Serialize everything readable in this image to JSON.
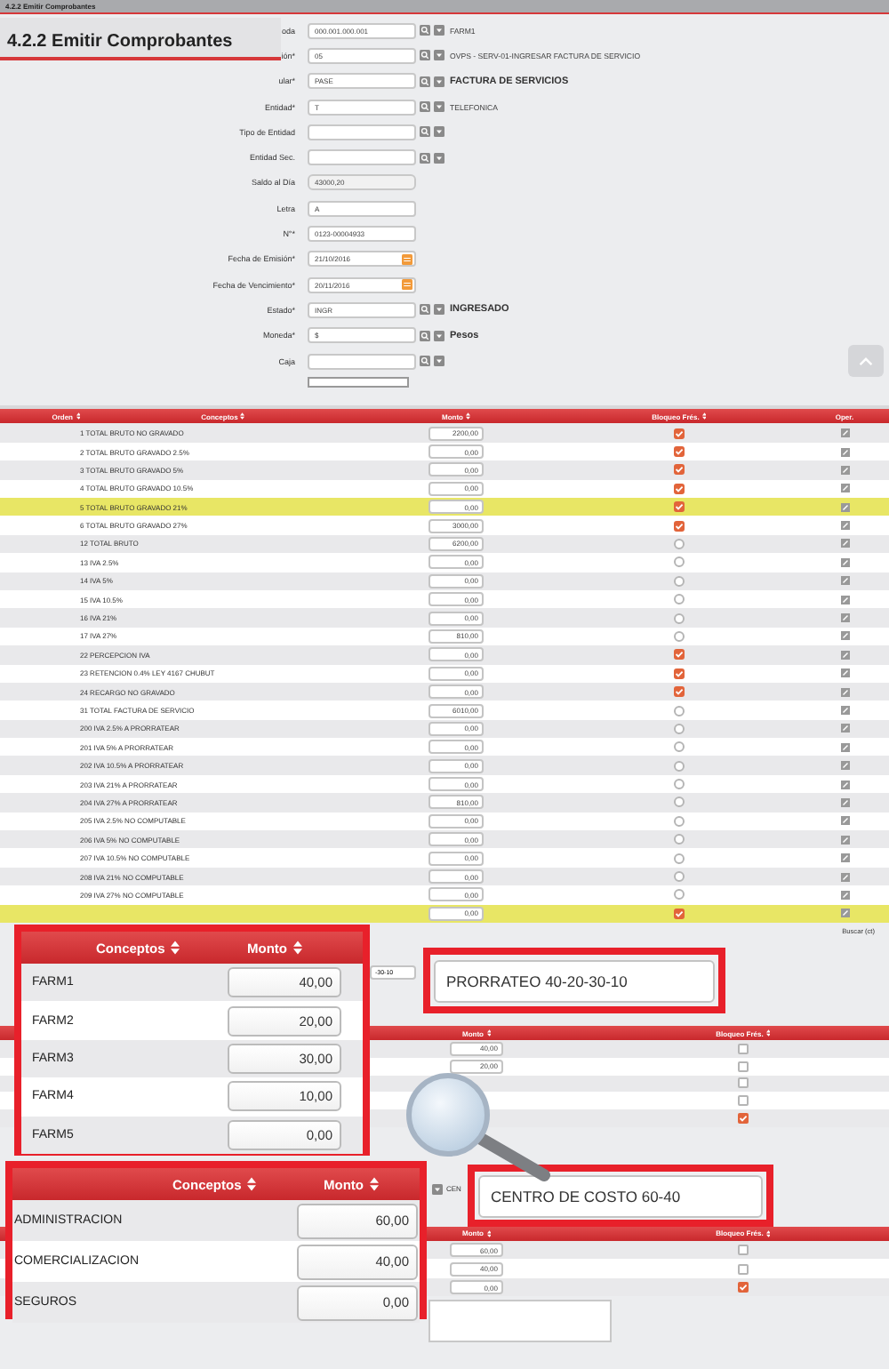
{
  "top_bar": {
    "title": "4.2.2 Emitir Comprobantes"
  },
  "page_title": "4.2.2 Emitir Comprobantes",
  "form": {
    "fields": [
      {
        "kind": "lookup",
        "label": "oda",
        "value": "000.001.000.001",
        "description": "FARM1",
        "emphasis": false
      },
      {
        "kind": "lookup",
        "label": "ión*",
        "value": "05",
        "description": "OVPS - SERV-01-INGRESAR FACTURA DE SERVICIO",
        "emphasis": false
      },
      {
        "kind": "lookup",
        "label": "ular*",
        "value": "PASE",
        "description": "FACTURA DE SERVICIOS",
        "emphasis": true
      },
      {
        "kind": "lookup",
        "label": "Entidad*",
        "value": "T",
        "description": "TELEFONICA",
        "emphasis": false
      },
      {
        "kind": "lookup",
        "label": "Tipo de Entidad"
      },
      {
        "kind": "lookup",
        "label": "Entidad Sec."
      },
      {
        "kind": "readonly",
        "label": "Saldo al Día",
        "value": "43000,20"
      },
      {
        "kind": "plain",
        "label": "Letra",
        "value": "A"
      },
      {
        "kind": "plain",
        "label": "N°*",
        "value": "0123-00004933"
      },
      {
        "kind": "date",
        "label": "Fecha de Emisión*",
        "value": "21/10/2016"
      },
      {
        "kind": "date",
        "label": "Fecha de Vencimiento*",
        "value": "20/11/2016"
      },
      {
        "kind": "lookup",
        "label": "Estado*",
        "value": "INGR",
        "description": "INGRESADO",
        "emphasis": true
      },
      {
        "kind": "lookup",
        "label": "Moneda*",
        "value": "$",
        "description": "Pesos",
        "emphasis": true
      },
      {
        "kind": "lookup",
        "label": "Caja"
      },
      {
        "kind": "select"
      }
    ]
  },
  "table": {
    "columns": [
      "Orden",
      "Conceptos",
      "Monto",
      "Bloqueo Frés.",
      "Oper."
    ],
    "rows": [
      {
        "concept": "1 TOTAL BRUTO NO GRAVADO",
        "amount": "2200,00",
        "blocked": true,
        "selected": false
      },
      {
        "concept": "2 TOTAL BRUTO GRAVADO 2.5%",
        "amount": "0,00",
        "blocked": true,
        "selected": false
      },
      {
        "concept": "3 TOTAL BRUTO GRAVADO 5%",
        "amount": "0,00",
        "blocked": true,
        "selected": false
      },
      {
        "concept": "4 TOTAL BRUTO GRAVADO 10.5%",
        "amount": "0,00",
        "blocked": true,
        "selected": false
      },
      {
        "concept": "5 TOTAL BRUTO GRAVADO 21%",
        "amount": "0,00",
        "blocked": true,
        "selected": true
      },
      {
        "concept": "6 TOTAL BRUTO GRAVADO 27%",
        "amount": "3000,00",
        "blocked": true,
        "selected": false
      },
      {
        "concept": "12 TOTAL BRUTO",
        "amount": "6200,00",
        "blocked": false,
        "selected": false
      },
      {
        "concept": "13 IVA 2.5%",
        "amount": "0,00",
        "blocked": false,
        "selected": false
      },
      {
        "concept": "14 IVA 5%",
        "amount": "0,00",
        "blocked": false,
        "selected": false
      },
      {
        "concept": "15 IVA 10.5%",
        "amount": "0,00",
        "blocked": false,
        "selected": false
      },
      {
        "concept": "16 IVA 21%",
        "amount": "0,00",
        "blocked": false,
        "selected": false
      },
      {
        "concept": "17 IVA 27%",
        "amount": "810,00",
        "blocked": false,
        "selected": false
      },
      {
        "concept": "22 PERCEPCION IVA",
        "amount": "0,00",
        "blocked": true,
        "selected": false
      },
      {
        "concept": "23 RETENCION 0.4% LEY 4167 CHUBUT",
        "amount": "0,00",
        "blocked": true,
        "selected": false
      },
      {
        "concept": "24 RECARGO NO GRAVADO",
        "amount": "0,00",
        "blocked": true,
        "selected": false
      },
      {
        "concept": "31 TOTAL FACTURA DE SERVICIO",
        "amount": "6010,00",
        "blocked": false,
        "selected": false
      },
      {
        "concept": "200 IVA 2.5% A PRORRATEAR",
        "amount": "0,00",
        "blocked": false,
        "selected": false
      },
      {
        "concept": "201 IVA 5% A PRORRATEAR",
        "amount": "0,00",
        "blocked": false,
        "selected": false
      },
      {
        "concept": "202 IVA 10.5% A PRORRATEAR",
        "amount": "0,00",
        "blocked": false,
        "selected": false
      },
      {
        "concept": "203 IVA 21% A PRORRATEAR",
        "amount": "0,00",
        "blocked": false,
        "selected": false
      },
      {
        "concept": "204 IVA 27% A PRORRATEAR",
        "amount": "810,00",
        "blocked": false,
        "selected": false
      },
      {
        "concept": "205 IVA 2.5% NO COMPUTABLE",
        "amount": "0,00",
        "blocked": false,
        "selected": false
      },
      {
        "concept": "206 IVA 5% NO COMPUTABLE",
        "amount": "0,00",
        "blocked": false,
        "selected": false
      },
      {
        "concept": "207 IVA 10.5% NO COMPUTABLE",
        "amount": "0,00",
        "blocked": false,
        "selected": false
      },
      {
        "concept": "208 IVA 21% NO COMPUTABLE",
        "amount": "0,00",
        "blocked": false,
        "selected": false
      },
      {
        "concept": "209 IVA 27% NO COMPUTABLE",
        "amount": "0,00",
        "blocked": false,
        "selected": false
      },
      {
        "amount": "0,00",
        "blocked": true,
        "selected": true
      }
    ]
  },
  "search_hint": "Buscar (ct)",
  "prorrateo_field": {
    "value": "-30-10"
  },
  "table_2": {
    "columns": [
      "Monto",
      "Bloqueo Frés."
    ],
    "rows": [
      {
        "amount": "40,00",
        "blocked": false
      },
      {
        "amount": "20,00",
        "blocked": false
      },
      {
        "blocked": false
      },
      {
        "blocked": false
      },
      {
        "blocked": true
      }
    ]
  },
  "cost_center": {
    "label": "CEN"
  },
  "table_3": {
    "columns": [
      "Monto",
      "Bloqueo Frés."
    ],
    "rows": [
      {
        "amount": "60,00",
        "blocked": false
      },
      {
        "amount": "40,00",
        "blocked": false
      },
      {
        "amount": "0,00",
        "blocked": true
      }
    ]
  },
  "callouts": [
    {
      "kind": "table",
      "columns": [
        "Conceptos",
        "Monto"
      ],
      "rows": [
        {
          "concept": "FARM1",
          "amount": "40,00"
        },
        {
          "concept": "FARM2",
          "amount": "20,00"
        },
        {
          "concept": "FARM3",
          "amount": "30,00"
        },
        {
          "concept": "FARM4",
          "amount": "10,00"
        },
        {
          "concept": "FARM5",
          "amount": "0,00"
        }
      ]
    },
    {
      "kind": "field",
      "value": "PRORRATEO 40-20-30-10"
    },
    {
      "kind": "table",
      "columns": [
        "Conceptos",
        "Monto"
      ],
      "rows": [
        {
          "concept": "ADMINISTRACION",
          "amount": "60,00"
        },
        {
          "concept": "COMERCIALIZACION",
          "amount": "40,00"
        },
        {
          "concept": "SEGUROS",
          "amount": "0,00"
        }
      ]
    },
    {
      "kind": "field",
      "value": "CENTRO DE COSTO 60-40"
    }
  ]
}
